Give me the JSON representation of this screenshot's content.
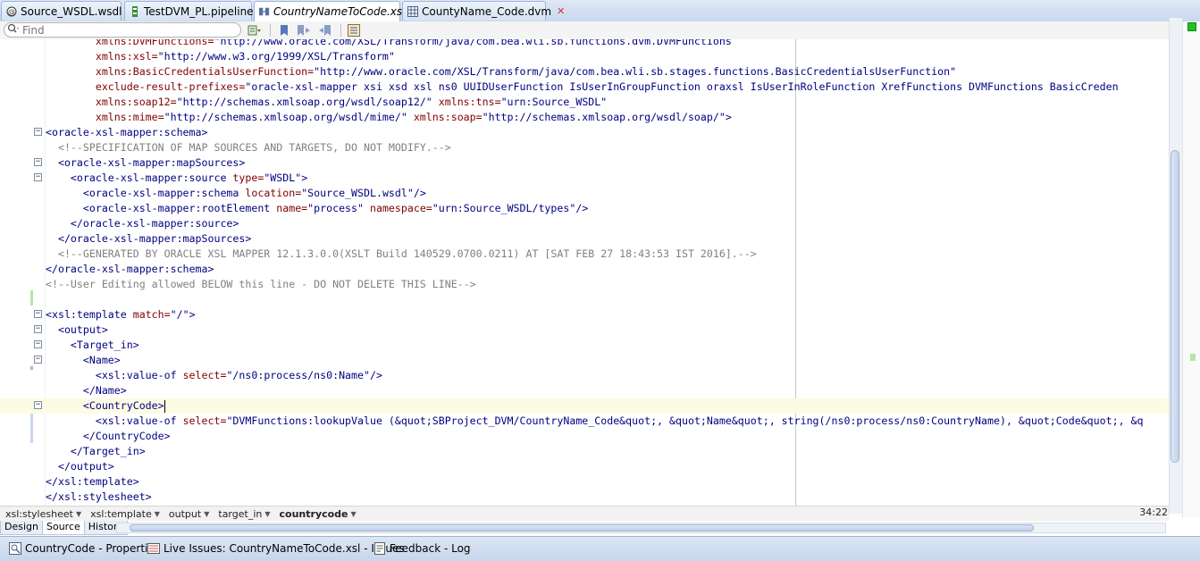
{
  "tabs": [
    {
      "label": "Source_WSDL.wsdl",
      "icon": "wsdl-file-icon",
      "active": false,
      "italic": false
    },
    {
      "label": "TestDVM_PL.pipeline",
      "icon": "pipeline-file-icon",
      "active": false,
      "italic": false
    },
    {
      "label": "CountryNameToCode.xsl",
      "icon": "xsl-file-icon",
      "active": true,
      "italic": true
    },
    {
      "label": "CountyName_Code.dvm",
      "icon": "dvm-file-icon",
      "active": false,
      "italic": false
    }
  ],
  "toolbar": {
    "find_placeholder": "Find",
    "buttons": [
      "search-options-icon",
      "find-next-icon",
      "toggle-bookmark-icon",
      "next-bookmark-icon",
      "previous-bookmark-icon",
      "xsl-map-view-icon"
    ]
  },
  "editor": {
    "lines": [
      {
        "segments": [
          [
            "a",
            "        xmlns:DVMFunctions="
          ],
          [
            "v",
            "\"http://www.oracle.com/XSL/Transform/java/com.bea.wli.sb.functions.dvm.DVMFunctions"
          ]
        ]
      },
      {
        "segments": [
          [
            "a",
            "        xmlns:xsl="
          ],
          [
            "v",
            "\"http://www.w3.org/1999/XSL/Transform\""
          ]
        ]
      },
      {
        "segments": [
          [
            "a",
            "        xmlns:BasicCredentialsUserFunction="
          ],
          [
            "v",
            "\"http://www.oracle.com/XSL/Transform/java/com.bea.wli.sb.stages.functions.BasicCredentialsUserFunction\""
          ]
        ]
      },
      {
        "segments": [
          [
            "a",
            "        exclude-result-prefixes="
          ],
          [
            "v",
            "\"oracle-xsl-mapper xsi xsd xsl ns0 UUIDUserFunction IsUserInGroupFunction oraxsl IsUserInRoleFunction XrefFunctions DVMFunctions BasicCreden"
          ]
        ]
      },
      {
        "segments": [
          [
            "a",
            "        xmlns:soap12="
          ],
          [
            "v",
            "\"http://schemas.xmlsoap.org/wsdl/soap12/\" "
          ],
          [
            "a",
            "xmlns:tns="
          ],
          [
            "v",
            "\"urn:Source_WSDL\""
          ]
        ]
      },
      {
        "segments": [
          [
            "a",
            "        xmlns:mime="
          ],
          [
            "v",
            "\"http://schemas.xmlsoap.org/wsdl/mime/\" "
          ],
          [
            "a",
            "xmlns:soap="
          ],
          [
            "v",
            "\"http://schemas.xmlsoap.org/wsdl/soap/\">"
          ]
        ]
      },
      {
        "fold": true,
        "segments": [
          [
            "t",
            "<oracle-xsl-mapper:schema>"
          ]
        ]
      },
      {
        "segments": [
          [
            "c",
            "  <!--SPECIFICATION OF MAP SOURCES AND TARGETS, DO NOT MODIFY.-->"
          ]
        ]
      },
      {
        "fold": true,
        "segments": [
          [
            "t",
            "  <oracle-xsl-mapper:mapSources>"
          ]
        ]
      },
      {
        "fold": true,
        "segments": [
          [
            "t",
            "    <oracle-xsl-mapper:source "
          ],
          [
            "a",
            "type="
          ],
          [
            "v",
            "\"WSDL\">"
          ]
        ]
      },
      {
        "segments": [
          [
            "t",
            "      <oracle-xsl-mapper:schema "
          ],
          [
            "a",
            "location="
          ],
          [
            "v",
            "\"Source_WSDL.wsdl\"/>"
          ]
        ]
      },
      {
        "segments": [
          [
            "t",
            "      <oracle-xsl-mapper:rootElement "
          ],
          [
            "a",
            "name="
          ],
          [
            "v",
            "\"process\" "
          ],
          [
            "a",
            "namespace="
          ],
          [
            "v",
            "\"urn:Source_WSDL/types\"/>"
          ]
        ]
      },
      {
        "segments": [
          [
            "t",
            "    </oracle-xsl-mapper:source>"
          ]
        ]
      },
      {
        "segments": [
          [
            "t",
            "  </oracle-xsl-mapper:mapSources>"
          ]
        ]
      },
      {
        "segments": [
          [
            "c",
            "  <!--GENERATED BY ORACLE XSL MAPPER 12.1.3.0.0(XSLT Build 140529.0700.0211) AT [SAT FEB 27 18:43:53 IST 2016].-->"
          ]
        ]
      },
      {
        "segments": [
          [
            "t",
            "</oracle-xsl-mapper:schema>"
          ]
        ]
      },
      {
        "segments": [
          [
            "c",
            "<!--User Editing allowed BELOW this line - DO NOT DELETE THIS LINE-->"
          ]
        ]
      },
      {
        "segments": [
          [
            "t",
            ""
          ]
        ]
      },
      {
        "fold": true,
        "segments": [
          [
            "t",
            "<xsl:template "
          ],
          [
            "a",
            "match="
          ],
          [
            "v",
            "\"/\">"
          ]
        ]
      },
      {
        "fold": true,
        "segments": [
          [
            "t",
            "  <output>"
          ]
        ]
      },
      {
        "fold": true,
        "segments": [
          [
            "t",
            "    <Target_in>"
          ]
        ]
      },
      {
        "fold": true,
        "segments": [
          [
            "t",
            "      <Name>"
          ]
        ]
      },
      {
        "segments": [
          [
            "t",
            "        <xsl:value-of "
          ],
          [
            "a",
            "select="
          ],
          [
            "v",
            "\"/ns0:process/ns0:Name\"/>"
          ]
        ]
      },
      {
        "segments": [
          [
            "t",
            "      </Name>"
          ]
        ]
      },
      {
        "fold": true,
        "current": true,
        "caret": true,
        "segments": [
          [
            "t",
            "      <CountryCode>"
          ]
        ]
      },
      {
        "segments": [
          [
            "t",
            "        <xsl:value-of "
          ],
          [
            "a",
            "select="
          ],
          [
            "v",
            "\"DVMFunctions:lookupValue (&quot;SBProject_DVM/CountryName_Code&quot;, &quot;Name&quot;, string(/ns0:process/ns0:CountryName), &quot;Code&quot;, &q"
          ]
        ]
      },
      {
        "segments": [
          [
            "t",
            "      </CountryCode>"
          ]
        ]
      },
      {
        "segments": [
          [
            "t",
            "    </Target_in>"
          ]
        ]
      },
      {
        "segments": [
          [
            "t",
            "  </output>"
          ]
        ]
      },
      {
        "segments": [
          [
            "t",
            "</xsl:template>"
          ]
        ]
      },
      {
        "segments": [
          [
            "t",
            "</xsl:stylesheet>"
          ]
        ]
      }
    ]
  },
  "breadcrumb": [
    "xsl:stylesheet",
    "xsl:template",
    "output",
    "target_in",
    "countrycode"
  ],
  "cursor_position": "34:22",
  "view_tabs": [
    {
      "label": "Design",
      "active": false
    },
    {
      "label": "Source",
      "active": true
    },
    {
      "label": "History",
      "active": false
    }
  ],
  "dock_tabs": [
    {
      "label": "CountryCode - Properties",
      "icon": "properties-icon"
    },
    {
      "label": "Live Issues: CountryNameToCode.xsl - Issues",
      "icon": "issues-icon"
    },
    {
      "label": "Feedback - Log",
      "icon": "log-icon"
    }
  ],
  "colors": {
    "tag": "#000080",
    "attribute": "#800000",
    "comment": "#808080",
    "current_line": "#fdfbe3"
  }
}
